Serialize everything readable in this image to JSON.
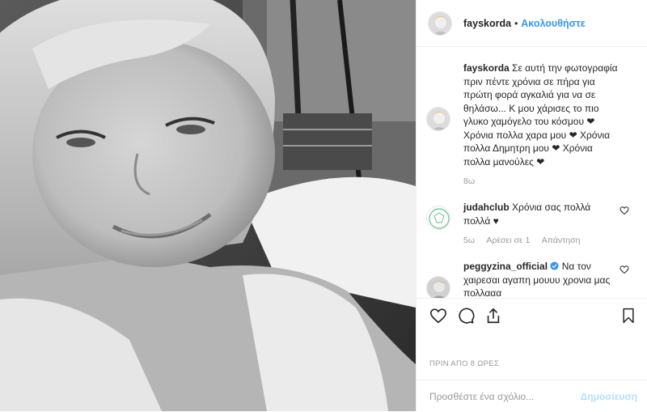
{
  "header": {
    "username": "fayskorda",
    "separator": "•",
    "follow_label": "Ακολουθήστε"
  },
  "caption": {
    "username": "fayskorda",
    "text": "Σε αυτή την φωτογραφία πριν πέντε χρόνια σε πήρα για πρώτη φορά αγκαλιά για να σε θηλάσω... Κ μου χάρισες το πιο γλυκο χαμόγελο του κόσμου ❤ Χρόνια πολλα χαρα μου ❤ Χρόνια πολλα Δημητρη μου ❤ Χρόνια πολλα μανούλες ❤",
    "age": "8ω"
  },
  "comments": [
    {
      "username": "judahclub",
      "text": "Χρόνια σας πολλά πολλά ♥",
      "age": "5ω",
      "likes": "Αρέσει σε 1",
      "reply": "Απάντηση"
    },
    {
      "username": "peggyzina_official",
      "text": "Να τον χαιρεσαι αγαπη μουυυ χρονια μας πολλααα"
    }
  ],
  "timestamp": "ΠΡΙΝ ΑΠΟ 8 ΩΡΕΣ",
  "add_comment": {
    "placeholder": "Προσθέστε ένα σχόλιο...",
    "post_label": "Δημοσίευση"
  },
  "colors": {
    "link": "#3897f0",
    "verified": "#3897f0",
    "muted": "#999999",
    "post_disabled": "#b2dffc"
  },
  "icons": [
    "heart-icon",
    "comment-icon",
    "share-icon",
    "bookmark-icon",
    "small-heart-icon",
    "verified-icon"
  ]
}
